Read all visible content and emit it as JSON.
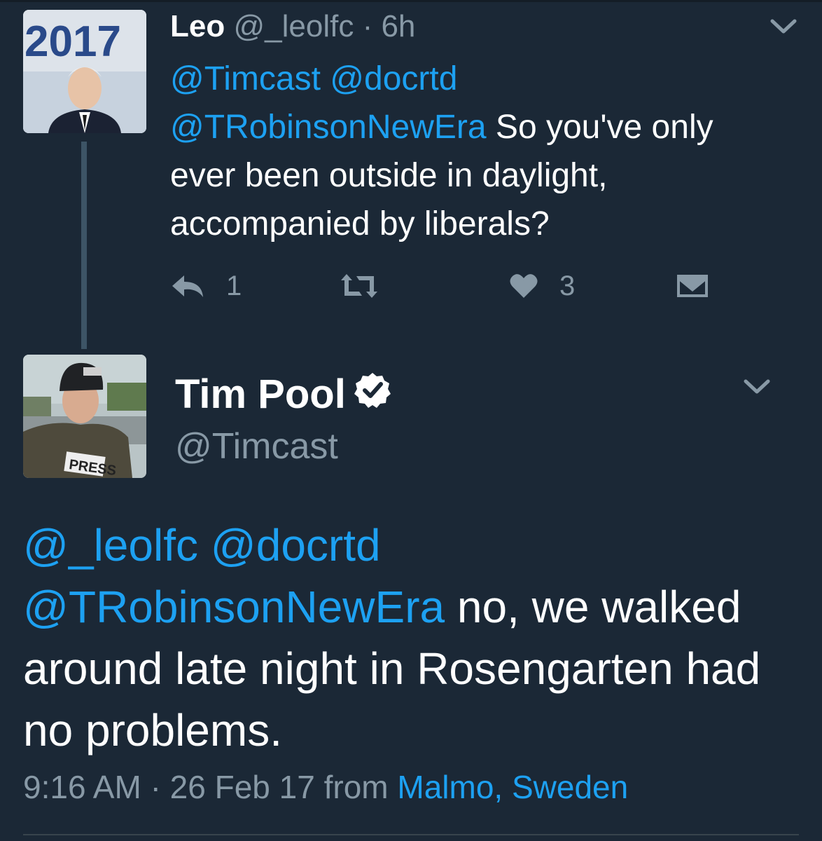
{
  "reply": {
    "name": "Leo",
    "handle": "@_leolfc",
    "separator": "·",
    "time": "6h",
    "mention1": "@Timcast",
    "mention2": "@docrtd",
    "mention3": "@TRobinsonNewEra",
    "text_line1": "So you've only",
    "text_rest": "ever been outside in daylight, accompanied by liberals?",
    "reply_count": "1",
    "like_count": "3",
    "avatar_icon": "profile-photo",
    "avatar_overlay_text": "2017"
  },
  "tweet": {
    "name": "Tim Pool",
    "handle": "@Timcast",
    "mention1": "@_leolfc",
    "mention2": "@docrtd",
    "mention3": "@TRobinsonNewEra",
    "text": "no, we walked around late night in Rosengarten had no problems.",
    "time": "9:16 AM",
    "separator": "·",
    "date": "26 Feb 17",
    "from_label": "from",
    "location": "Malmo, Sweden",
    "avatar_icon": "profile-photo",
    "avatar_overlay_text": "PRESS"
  },
  "colors": {
    "background": "#1b2836",
    "link": "#1da1f2",
    "muted": "#8899a6",
    "thread_line": "#3d5466"
  }
}
